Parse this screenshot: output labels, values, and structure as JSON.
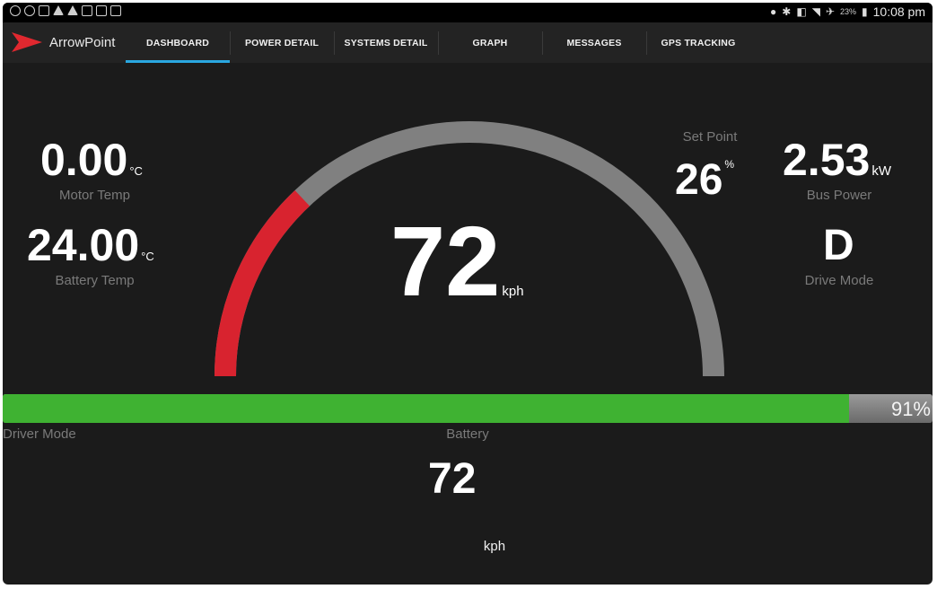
{
  "status_bar": {
    "battery_small": "23%",
    "time": "10:08 pm"
  },
  "app": {
    "name": "ArrowPoint",
    "brand_color": "#e0282f",
    "accent_color": "#2aa7e0"
  },
  "tabs": [
    {
      "label": "DASHBOARD",
      "active": true
    },
    {
      "label": "POWER DETAIL",
      "active": false
    },
    {
      "label": "SYSTEMS DETAIL",
      "active": false
    },
    {
      "label": "GRAPH",
      "active": false
    },
    {
      "label": "MESSAGES",
      "active": false
    },
    {
      "label": "GPS TRACKING",
      "active": false
    }
  ],
  "dashboard": {
    "motor_temp": {
      "value": "0.00",
      "unit": "°C",
      "label": "Motor Temp"
    },
    "battery_temp": {
      "value": "24.00",
      "unit": "°C",
      "label": "Battery Temp"
    },
    "set_point": {
      "label": "Set Point",
      "value": "26",
      "unit": "%"
    },
    "bus_power": {
      "value": "2.53",
      "unit": "kW",
      "label": "Bus Power"
    },
    "drive_mode": {
      "value": "D",
      "label": "Drive Mode"
    },
    "speed": {
      "value": "72",
      "unit": "kph"
    },
    "gauge": {
      "set_point_fraction": 0.26,
      "active_color": "#d8232f",
      "track_color": "#808080"
    }
  },
  "battery_bar": {
    "percent": 91,
    "percent_text": "91%",
    "fill_color": "#3fb232"
  },
  "footer": {
    "driver_mode_label": "Driver Mode",
    "battery_label": "Battery",
    "speed_value": "72",
    "speed_unit": "kph"
  }
}
